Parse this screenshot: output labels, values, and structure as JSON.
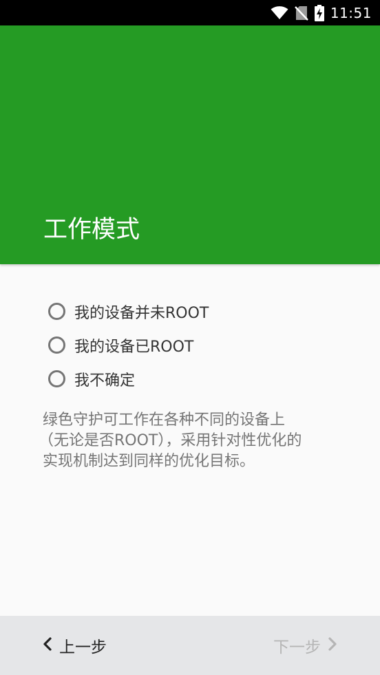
{
  "status_bar": {
    "time": "11:51",
    "icons": [
      "wifi-icon",
      "no-sim-icon",
      "battery-charging-icon"
    ]
  },
  "header": {
    "title": "工作模式",
    "background_color": "#259b24"
  },
  "options": [
    {
      "label": "我的设备并未ROOT",
      "selected": false
    },
    {
      "label": "我的设备已ROOT",
      "selected": false
    },
    {
      "label": "我不确定",
      "selected": false
    }
  ],
  "description": {
    "line1": "绿色守护可工作在各种不同的设备上",
    "line2": "（无论是否ROOT），采用针对性优化的",
    "line3": "实现机制达到同样的优化目标。"
  },
  "navigation": {
    "prev_label": "上一步",
    "next_label": "下一步",
    "next_enabled": false
  }
}
